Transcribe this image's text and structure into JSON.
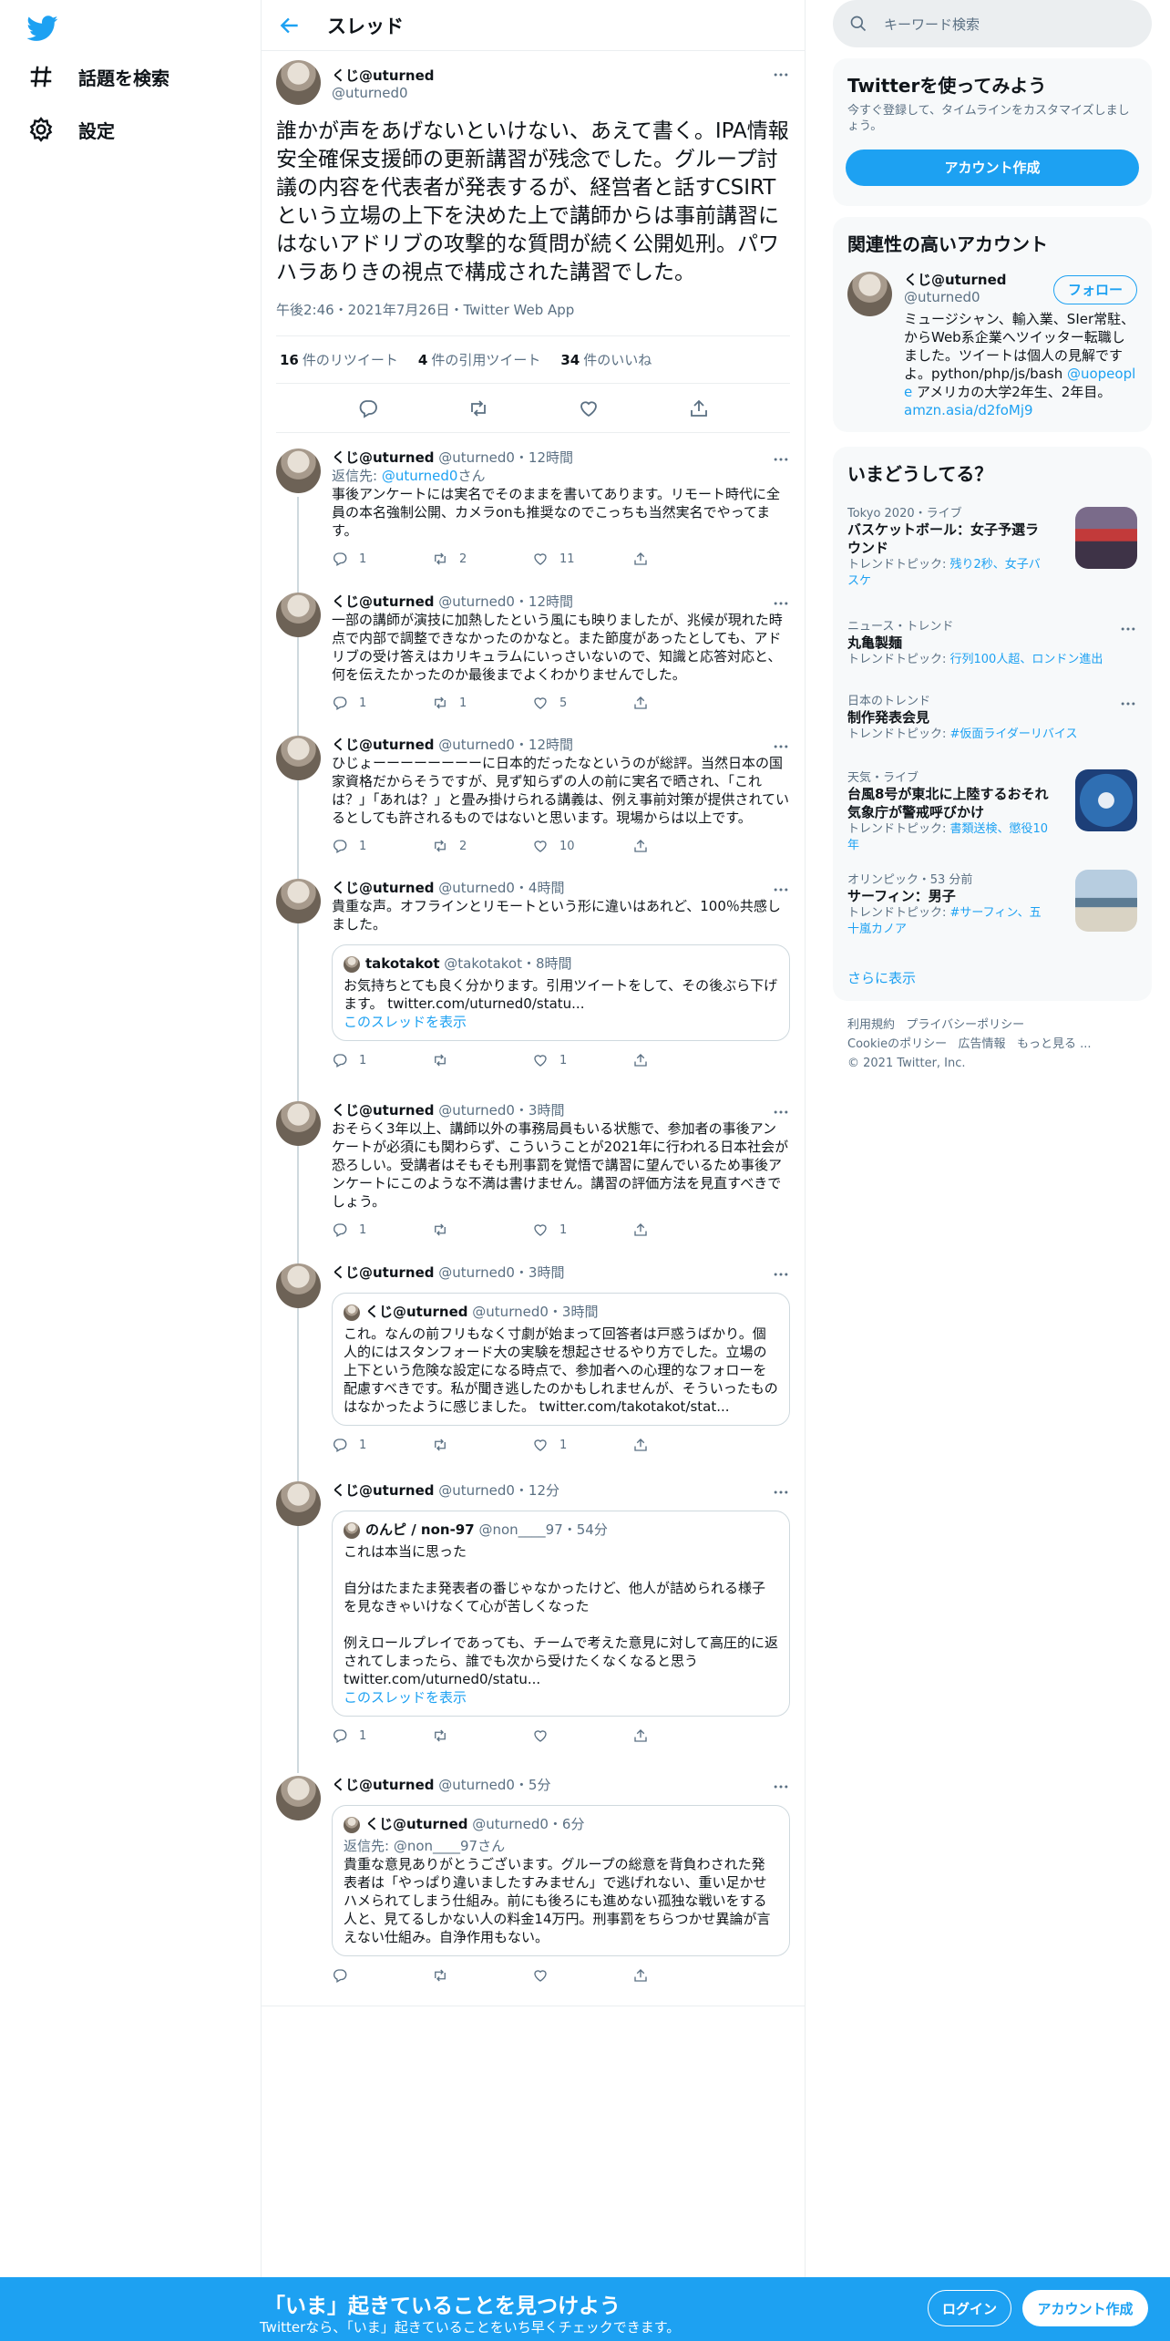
{
  "nav": {
    "explore": "話題を検索",
    "settings": "設定"
  },
  "header": {
    "title": "スレッド"
  },
  "focal": {
    "name": "くじ@uturned",
    "handle": "@uturned0",
    "text": "誰かが声をあげないといけない、あえて書く。IPA情報安全確保支援師の更新講習が残念でした。グループ討議の内容を代表者が発表するが、経営者と話すCSIRTという立場の上下を決めた上で講師からは事前講習にはないアドリブの攻撃的な質問が続く公開処刑。パワハラありきの視点で構成された講習でした。",
    "meta": "午後2:46・2021年7月26日・Twitter Web App",
    "retweets": "16",
    "retweets_label": "件のリツイート",
    "quotes": "4",
    "quotes_label": "件の引用ツイート",
    "likes": "34",
    "likes_label": "件のいいね"
  },
  "replies": [
    {
      "name": "くじ@uturned",
      "meta": "@uturned0・12時間",
      "reply_to_prefix": "返信先: ",
      "reply_to": "@uturned0",
      "reply_to_suffix": "さん",
      "text": "事後アンケートには実名でそのままを書いてあります。リモート時代に全員の本名強制公開、カメラonも推奨なのでこっちも当然実名でやってます。",
      "c": "1",
      "r": "2",
      "l": "11"
    },
    {
      "name": "くじ@uturned",
      "meta": "@uturned0・12時間",
      "text": "一部の講師が演技に加熱したという風にも映りましたが、兆候が現れた時点で内部で調整できなかったのかなと。また節度があったとしても、アドリブの受け答えはカリキュラムにいっさいないので、知識と応答対応と、何を伝えたかったのか最後までよくわかりませんでした。",
      "c": "1",
      "r": "1",
      "l": "5"
    },
    {
      "name": "くじ@uturned",
      "meta": "@uturned0・12時間",
      "text": "ひじょーーーーーーーーに日本的だったなというのが総評。当然日本の国家資格だからそうですが、見ず知らずの人の前に実名で晒され、「これは？」「あれは？」と畳み掛けられる講義は、例え事前対策が提供されているとしても許されるものではないと思います。現場からは以上です。",
      "c": "1",
      "r": "2",
      "l": "10"
    },
    {
      "name": "くじ@uturned",
      "meta": "@uturned0・4時間",
      "text": "貴重な声。オフラインとリモートという形に違いはあれど、100％共感しました。",
      "c": "1",
      "r": "",
      "l": "1",
      "quote": {
        "name": "takotakot",
        "meta": "@takotakot・8時間",
        "text": "お気持ちとても良く分かります。引用ツイートをして、その後ぶら下げます。 twitter.com/uturned0/statu...",
        "link": "このスレッドを表示"
      }
    },
    {
      "name": "くじ@uturned",
      "meta": "@uturned0・3時間",
      "text": "おそらく3年以上、講師以外の事務局員もいる状態で、参加者の事後アンケートが必須にも関わらず、こういうことが2021年に行われる日本社会が恐ろしい。受講者はそもそも刑事罰を覚悟で講習に望んでいるため事後アンケートにこのような不満は書けません。講習の評価方法を見直すべきでしょう。",
      "c": "1",
      "r": "",
      "l": "1"
    },
    {
      "name": "くじ@uturned",
      "meta": "@uturned0・3時間",
      "text": "",
      "c": "1",
      "r": "",
      "l": "1",
      "quote": {
        "name": "くじ@uturned",
        "meta": "@uturned0・3時間",
        "text": "これ。なんの前フリもなく寸劇が始まって回答者は戸惑うばかり。個人的にはスタンフォード大の実験を想起させるやり方でした。立場の上下という危険な設定になる時点で、参加者への心理的なフォローを配慮すべきです。私が聞き逃したのかもしれませんが、そういったものはなかったように感じました。 twitter.com/takotakot/stat...",
        "link": ""
      }
    },
    {
      "name": "くじ@uturned",
      "meta": "@uturned0・12分",
      "text": "",
      "c": "1",
      "r": "",
      "l": "",
      "quote": {
        "name": "のんピ / non-97",
        "meta": "@non____97・54分",
        "text": "これは本当に思った\n\n自分はたまたま発表者の番じゃなかったけど、他人が詰められる様子を見なきゃいけなくて心が苦しくなった\n\n例えロールプレイであっても、チームで考えた意見に対して高圧的に返されてしまったら、誰でも次から受けたくなくなると思う\ntwitter.com/uturned0/statu...",
        "link": "このスレッドを表示"
      }
    },
    {
      "name": "くじ@uturned",
      "meta": "@uturned0・5分",
      "text": "",
      "c": "",
      "r": "",
      "l": "",
      "quote": {
        "name": "くじ@uturned",
        "meta": "@uturned0・6分",
        "reply": "返信先: @non____97さん",
        "text": "貴重な意見ありがとうございます。グループの総意を背負わされた発表者は「やっぱり違いましたすみません」で逃げれない、重い足かせハメられてしまう仕組み。前にも後ろにも進めない孤独な戦いをする人と、見てるしかない人の料金14万円。刑事罰をちらつかせ異論が言えない仕組み。自浄作用もない。",
        "link": ""
      }
    }
  ],
  "right": {
    "search_placeholder": "キーワード検索",
    "signup": {
      "title": "Twitterを使ってみよう",
      "desc": "今すぐ登録して、タイムラインをカスタマイズしましょう。",
      "button": "アカウント作成"
    },
    "relevant": {
      "title": "関連性の高いアカウント",
      "name": "くじ@uturned",
      "handle": "@uturned0",
      "follow": "フォロー",
      "bio1": "ミュージシャン、輸入業、SIer常駐、からWeb系企業へツイッター転職しました。ツイートは個人の見解ですよ。python/php/js/bash ",
      "bio_mention": "@uopeople",
      "bio2": " アメリカの大学2年生、2年目。",
      "bio_link": "amzn.asia/d2foMj9"
    },
    "trends_title": "いまどうしてる？",
    "trends": [
      {
        "cat": "Tokyo 2020・ライブ",
        "title": "バスケットボール：女子予選ラウンド",
        "topic_prefix": "トレンドトピック: ",
        "topic": "残り2秒、女子バスケ"
      },
      {
        "cat": "ニュース・トレンド",
        "title": "丸亀製麺",
        "topic_prefix": "トレンドトピック: ",
        "topic": "行列100人超、ロンドン進出"
      },
      {
        "cat": "日本のトレンド",
        "title": "制作発表会見",
        "topic_prefix": "トレンドトピック: ",
        "topic": "#仮面ライダーリバイス"
      },
      {
        "cat": "天気・ライブ",
        "title": "台風8号が東北に上陸するおそれ 気象庁が警戒呼びかけ",
        "topic_prefix": "トレンドトピック: ",
        "topic": "書類送検、懲役10年"
      },
      {
        "cat": "オリンピック・53 分前",
        "title": "サーフィン：男子",
        "topic_prefix": "トレンドトピック: ",
        "topic": "#サーフィン",
        "topic2": "、五十嵐カノア"
      }
    ],
    "more": "さらに表示",
    "footer": {
      "l1a": "利用規約",
      "l1b": "プライバシーポリシー",
      "l2a": "Cookieのポリシー",
      "l2b": "広告情報",
      "l2c": "もっと見る ...",
      "l3": "© 2021 Twitter, Inc."
    }
  },
  "banner": {
    "title": "「いま」起きていることを見つけよう",
    "sub": "Twitterなら、「いま」起きていることをいち早くチェックできます。",
    "login": "ログイン",
    "signup": "アカウント作成"
  },
  "colors": {
    "accent": "#1da1f2",
    "text": "#0f1419",
    "secondary": "#5b7083"
  }
}
